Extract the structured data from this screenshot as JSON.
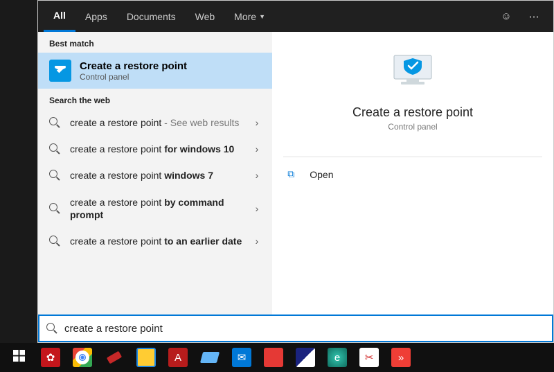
{
  "tabs": {
    "all": "All",
    "apps": "Apps",
    "documents": "Documents",
    "web": "Web",
    "more": "More"
  },
  "sections": {
    "best_match": "Best match",
    "search_web": "Search the web"
  },
  "best_match": {
    "title": "Create a restore point",
    "subtitle": "Control panel"
  },
  "web_results": [
    {
      "prefix": "create a restore point",
      "bold": "",
      "suffix": " - See web results"
    },
    {
      "prefix": "create a restore point ",
      "bold": "for windows 10",
      "suffix": ""
    },
    {
      "prefix": "create a restore point ",
      "bold": "windows 7",
      "suffix": ""
    },
    {
      "prefix": "create a restore point ",
      "bold": "by command prompt",
      "suffix": ""
    },
    {
      "prefix": "create a restore point ",
      "bold": "to an earlier date",
      "suffix": ""
    }
  ],
  "detail": {
    "title": "Create a restore point",
    "subtitle": "Control panel",
    "open": "Open"
  },
  "search_input": {
    "value": "create a restore point"
  },
  "colors": {
    "accent": "#0078d7",
    "selected": "#bfdef7"
  },
  "taskbar_apps": [
    {
      "name": "huawei",
      "color": "#c4161c",
      "glyph": "✿"
    },
    {
      "name": "chrome",
      "color": "#ffffff",
      "glyph": "◉"
    },
    {
      "name": "usb",
      "color": "#c62828",
      "glyph": "⚮"
    },
    {
      "name": "file-explorer",
      "color": "#ffcc33",
      "glyph": "🗀"
    },
    {
      "name": "pdf",
      "color": "#b71c1c",
      "glyph": "⎘"
    },
    {
      "name": "notes",
      "color": "#1e88e5",
      "glyph": "▰"
    },
    {
      "name": "mail",
      "color": "#0078d7",
      "glyph": "✉"
    },
    {
      "name": "red-box",
      "color": "#e53935",
      "glyph": ""
    },
    {
      "name": "launcher",
      "color": "#1a237e",
      "glyph": "◤"
    },
    {
      "name": "edge",
      "color": "#0f6d5f",
      "glyph": "◯"
    },
    {
      "name": "snip",
      "color": "#ffffff",
      "glyph": "✂"
    },
    {
      "name": "anydesk",
      "color": "#ef3e36",
      "glyph": "▶"
    }
  ]
}
